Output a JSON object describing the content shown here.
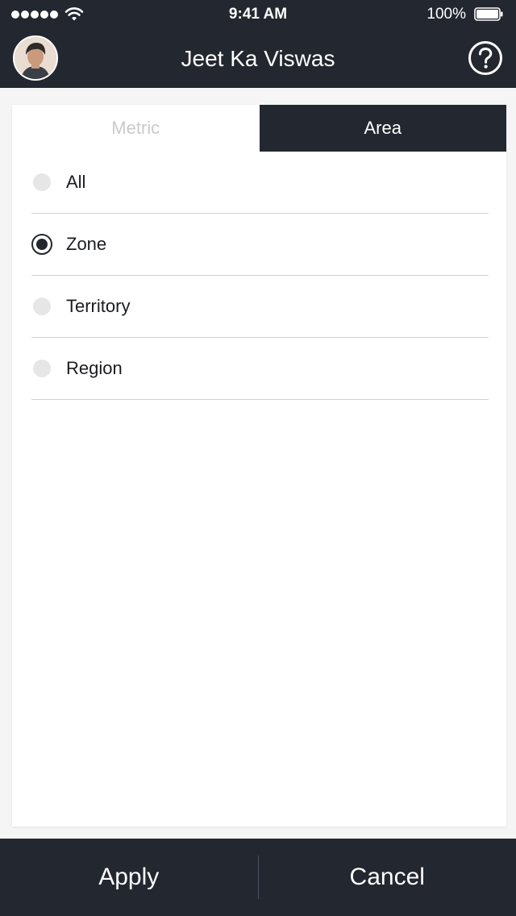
{
  "status_bar": {
    "time": "9:41 AM",
    "battery_percent": "100%",
    "signal_bars": 5
  },
  "header": {
    "title": "Jeet Ka Viswas",
    "help_icon": "question-circle-icon",
    "avatar_icon": "user-avatar"
  },
  "tabs": [
    {
      "label": "Metric",
      "active": false
    },
    {
      "label": "Area",
      "active": true
    }
  ],
  "options": [
    {
      "label": "All",
      "selected": false
    },
    {
      "label": "Zone",
      "selected": true
    },
    {
      "label": "Territory",
      "selected": false
    },
    {
      "label": "Region",
      "selected": false
    }
  ],
  "footer": {
    "apply_label": "Apply",
    "cancel_label": "Cancel"
  },
  "colors": {
    "primary_dark": "#23272f",
    "inactive_tab_text": "#c9cacc",
    "radio_unselected": "#e6e6e7",
    "background": "#f5f5f6"
  }
}
